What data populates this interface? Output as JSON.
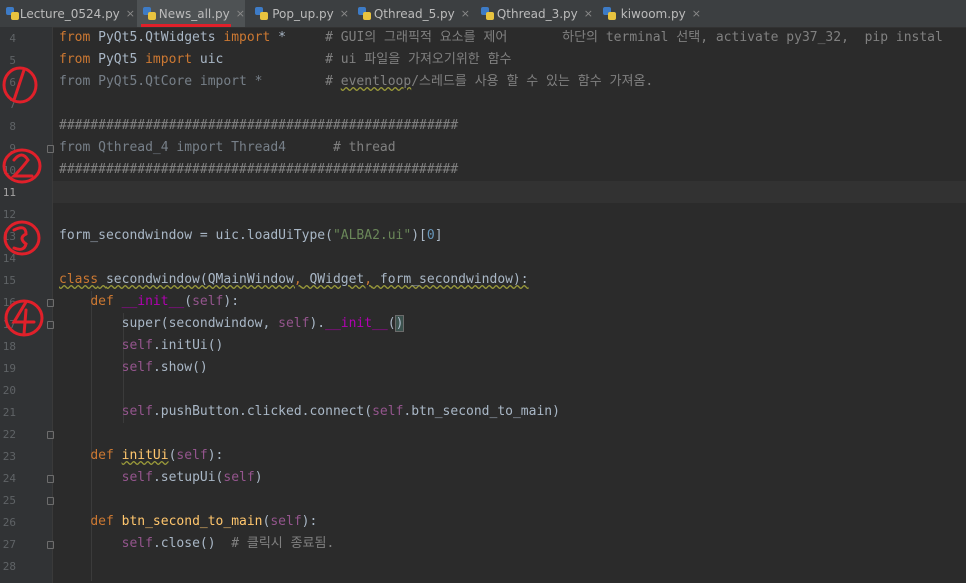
{
  "tabs": [
    {
      "label": "Lecture_0524.py",
      "active": false
    },
    {
      "label": "News_all.py",
      "active": true
    },
    {
      "label": "Pop_up.py",
      "active": false
    },
    {
      "label": "Qthread_5.py",
      "active": false
    },
    {
      "label": "Qthread_3.py",
      "active": false
    },
    {
      "label": "kiwoom.py",
      "active": false
    }
  ],
  "close_glyph": "×",
  "line_numbers": [
    "4",
    "5",
    "6",
    "7",
    "8",
    "9",
    "10",
    "11",
    "12",
    "13",
    "14",
    "15",
    "16",
    "17",
    "18",
    "19",
    "20",
    "21",
    "22",
    "23",
    "24",
    "25",
    "26",
    "27",
    "28"
  ],
  "current_line": "11",
  "code": {
    "l4": {
      "a": "from",
      "b": " PyQt5.QtWidgets ",
      "c": "import",
      "d": " *     ",
      "e": "# GUI의 그래픽적 요소를 제어       하단의 terminal 선택, activate py37_32,  pip instal"
    },
    "l5": {
      "a": "from",
      "b": " PyQt5 ",
      "c": "import",
      "d": " uic             ",
      "e": "# ui 파일을 가져오기위한 함수"
    },
    "l6": {
      "a": "from PyQt5.QtCore import *        ",
      "b": "# ",
      "c": "eventloop",
      "d": "/스레드를 사용 할 수 있는 함수 가져옴."
    },
    "l8": "###################################################",
    "l9": {
      "a": "from Qthread_4 import Thread4      ",
      "b": "# thread"
    },
    "l10": "###################################################",
    "l13": {
      "a": "form_secondwindow = uic.loadUiType(",
      "b": "\"ALBA2.ui\"",
      "c": ")[",
      "d": "0",
      "e": "]"
    },
    "l15": {
      "a": "class",
      "b": " ",
      "c": "secondwindow(QMainWindow",
      "d": ",",
      "e": " QWidget",
      "f": ",",
      "g": " form_secondwindow):"
    },
    "l16": {
      "a": "    ",
      "b": "def",
      "c": " ",
      "d": "__init__",
      "e": "(",
      "f": "self",
      "g": "):"
    },
    "l17": {
      "a": "        super(secondwindow, ",
      "b": "self",
      "c": ").",
      "d": "__init__",
      "e": "(",
      "f": ")"
    },
    "l18": {
      "a": "        ",
      "b": "self",
      "c": ".initUi()"
    },
    "l19": {
      "a": "        ",
      "b": "self",
      "c": ".show()"
    },
    "l21": {
      "a": "        ",
      "b": "self",
      "c": ".pushButton.clicked.connect(",
      "d": "self",
      "e": ".btn_second_to_main)"
    },
    "l23": {
      "a": "    ",
      "b": "def",
      "c": " ",
      "d": "initUi",
      "e": "(",
      "f": "self",
      "g": "):"
    },
    "l24": {
      "a": "        ",
      "b": "self",
      "c": ".setupUi(",
      "d": "self",
      "e": ")"
    },
    "l26": {
      "a": "    ",
      "b": "def",
      "c": " ",
      "d": "btn_second_to_main",
      "e": "(",
      "f": "self",
      "g": "):"
    },
    "l27": {
      "a": "        ",
      "b": "self",
      "c": ".close()  ",
      "d": "# 클릭시 종료됨."
    }
  },
  "annotation_color": "#e0202a"
}
